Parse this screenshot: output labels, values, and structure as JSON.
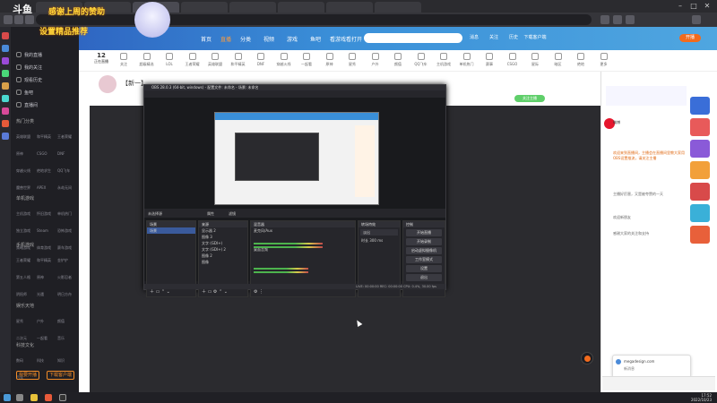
{
  "browser": {
    "window_controls": [
      "–",
      "□",
      "✕"
    ]
  },
  "douyu": {
    "logo_text": "斗鱼",
    "banner_text_1": "感谢上周的赞助",
    "banner_text_2": "设置精品推荐",
    "header_nav": [
      "首页",
      "直播",
      "分类",
      "视频",
      "游戏",
      "鱼吧",
      "看游戏看打开"
    ],
    "header_icons": [
      "消息",
      "关注",
      "历史",
      "下载客户端",
      "开播"
    ],
    "categories": [
      "关注",
      "超级精选",
      "LOL",
      "王者荣耀",
      "英雄联盟",
      "和平精英",
      "DNF",
      "穿越火线",
      "一起看",
      "原神",
      "星秀",
      "户外",
      "颜值",
      "QQ飞车",
      "主机游戏",
      "单机热门",
      "赛事",
      "CSGO",
      "星际",
      "暗区",
      "绝地",
      "更多"
    ],
    "live_count": "12",
    "live_label": "正在直播",
    "sidebar_top": [
      "我的直播",
      "我的关注",
      "观看历史",
      "鱼吧",
      "直播间"
    ],
    "sidebar_sections": [
      {
        "title": "热门分类",
        "items": [
          "英雄联盟",
          "和平精英",
          "王者荣耀",
          "原神",
          "CSGO",
          "DNF",
          "穿越火线",
          "绝地求生",
          "QQ飞车",
          "魔兽世界",
          "APEX",
          "永劫无间"
        ]
      },
      {
        "title": "单机游戏",
        "items": [
          "主机游戏",
          "怀旧游戏",
          "单机热门",
          "独立游戏",
          "Steam",
          "恐怖游戏",
          "策略游戏",
          "体育游戏",
          "赛车游戏"
        ]
      },
      {
        "title": "手机游戏",
        "items": [
          "王者荣耀",
          "和平精英",
          "金铲铲",
          "第五人格",
          "原神",
          "火影忍者",
          "阴阳师",
          "光遇",
          "明日方舟"
        ]
      },
      {
        "title": "娱乐天地",
        "items": [
          "星秀",
          "户外",
          "颜值",
          "二次元",
          "一起看",
          "音乐"
        ]
      },
      {
        "title": "科技文化",
        "items": [
          "数码",
          "科技",
          "知识",
          "汽车"
        ]
      }
    ],
    "sidebar_buttons": [
      "我要开播",
      "下载客户端"
    ],
    "room": {
      "title": "【新一】",
      "follow_label": "关注主播"
    }
  },
  "obs": {
    "title": "OBS 28.0.3 (64-bit, windows) - 配置文件: 未命名 - 场景: 未命名",
    "menu": [
      "文件(F)",
      "编辑(E)",
      "视图(V)",
      "停靠窗口(D)",
      "配置文件(P)",
      "场景集合(S)",
      "工具(T)",
      "帮助(H)"
    ],
    "source_bar": {
      "no_source": "未选择源",
      "props": "属性",
      "filters": "滤镜"
    },
    "docks": {
      "scenes": {
        "title": "场景",
        "items": [
          "场景"
        ]
      },
      "sources": {
        "title": "来源",
        "items": [
          "显示器 2",
          "图像 3",
          "文字 (GDI+)",
          "文字 (GDI+) 2",
          "图像 2",
          "图像"
        ]
      },
      "mixer": {
        "title": "混音器",
        "channels": [
          {
            "name": "麦克风/Aux",
            "level": 0.7
          },
          {
            "name": "桌面音频",
            "level": 0.55
          }
        ]
      },
      "transitions": {
        "title": "转场特效",
        "type": "淡出",
        "duration_label": "时长",
        "duration": "300 ms"
      },
      "controls": {
        "title": "控制",
        "buttons": [
          "开始直播",
          "开始录制",
          "启动虚拟摄像机",
          "工作室模式",
          "设置",
          "退出"
        ]
      }
    },
    "status": "LIVE: 00:00:00   REC: 00:00:00   CPU: 0.4%, 30.00 fps"
  },
  "chat": {
    "messages": [
      "主播好厉害，又是被夸赞的一天",
      "欢迎来到直播间，主播会在直播间里教大家用OBS设置推流，请关注主播",
      "欢迎新朋友",
      "感谢大家的关注和支持"
    ],
    "weibo_label": "微博",
    "notify_title": "megadesign.com",
    "notify_sub": "新消息"
  },
  "taskbar": {
    "time": "17:52",
    "date": "2022/10/23"
  },
  "colors": {
    "douyu_orange": "#f26b1d",
    "header_blue": "#3a8fd8",
    "follow_green": "#5fcf6a",
    "obs_select": "#3a5a9c"
  }
}
